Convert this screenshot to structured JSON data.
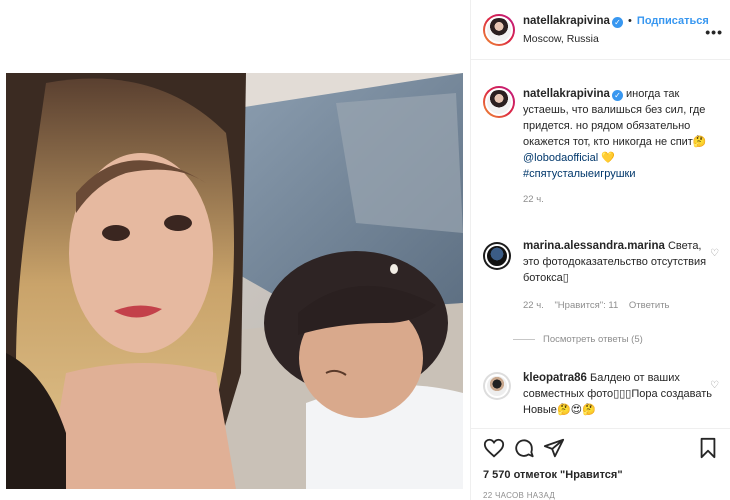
{
  "post": {
    "username": "natellakrapivina",
    "follow_label": "Подписаться",
    "separator": "•",
    "location": "Moscow, Russia",
    "caption_user": "natellakrapivina",
    "caption_text": "иногда так устаешь, что валишься без сил, где придется. но рядом обязательно окажется тот, кто никогда не спит",
    "caption_emoji_1": "🤔",
    "caption_mention": "@lobodaofficial",
    "caption_emoji_2": "💛",
    "caption_hashtag": "#спятусталыеигрушки",
    "caption_time": "22 ч."
  },
  "comments": [
    {
      "user": "marina.alessandra.marina",
      "text": "Света, это фотодоказательство отсутствия ботокса",
      "text_tail": "▯",
      "time": "22 ч.",
      "likes": "\"Нравится\": 11",
      "reply": "Ответить",
      "view_replies": "Посмотреть ответы (5)"
    },
    {
      "user": "kleopatra86",
      "text": "Балдею от ваших совместных фото",
      "text_mid": "▯▯▯",
      "text_2": "Пора создавать Новые",
      "text_emoji": "🤔😍🤔"
    }
  ],
  "footer": {
    "likes": "7 570 отметок \"Нравится\"",
    "time": "22 ЧАСОВ НАЗАД"
  },
  "icons": [
    "verified-badge-icon",
    "more-options-icon",
    "heart-icon",
    "comment-icon",
    "share-icon",
    "bookmark-icon"
  ],
  "colors": {
    "link": "#3897f0",
    "tag": "#00376b",
    "muted": "#8e8e8e"
  }
}
